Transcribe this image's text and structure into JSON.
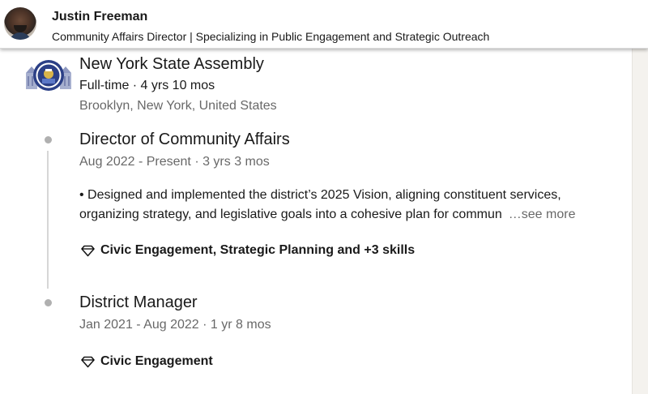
{
  "header": {
    "name": "Justin Freeman",
    "headline": "Community Affairs Director | Specializing in Public Engagement and Strategic Outreach"
  },
  "company": {
    "name": "New York State Assembly",
    "employment": "Full-time · 4 yrs 10 mos",
    "location": "Brooklyn, New York, United States",
    "logo_icon": "seal-icon"
  },
  "roles": [
    {
      "title": "Director of Community Affairs",
      "dates": "Aug 2022 - Present · 3 yrs 3 mos",
      "description_line1": "• Designed and implemented the district’s 2025 Vision, aligning constituent services,",
      "description_line2": "organizing strategy, and legislative goals into a cohesive plan for commun",
      "see_more": "…see more",
      "skills": "Civic Engagement, Strategic Planning and +3 skills",
      "skills_icon": "diamond-icon"
    },
    {
      "title": "District Manager",
      "dates": "Jan 2021 - Aug 2022 · 1 yr 8 mos",
      "skills": "Civic Engagement",
      "skills_icon": "diamond-icon"
    }
  ],
  "colors": {
    "timeline_dot": "#b0b0b0",
    "timeline_line": "#d6d6d6",
    "secondary_text": "rgba(0,0,0,0.6)",
    "seal_blue": "#2b3f86"
  }
}
